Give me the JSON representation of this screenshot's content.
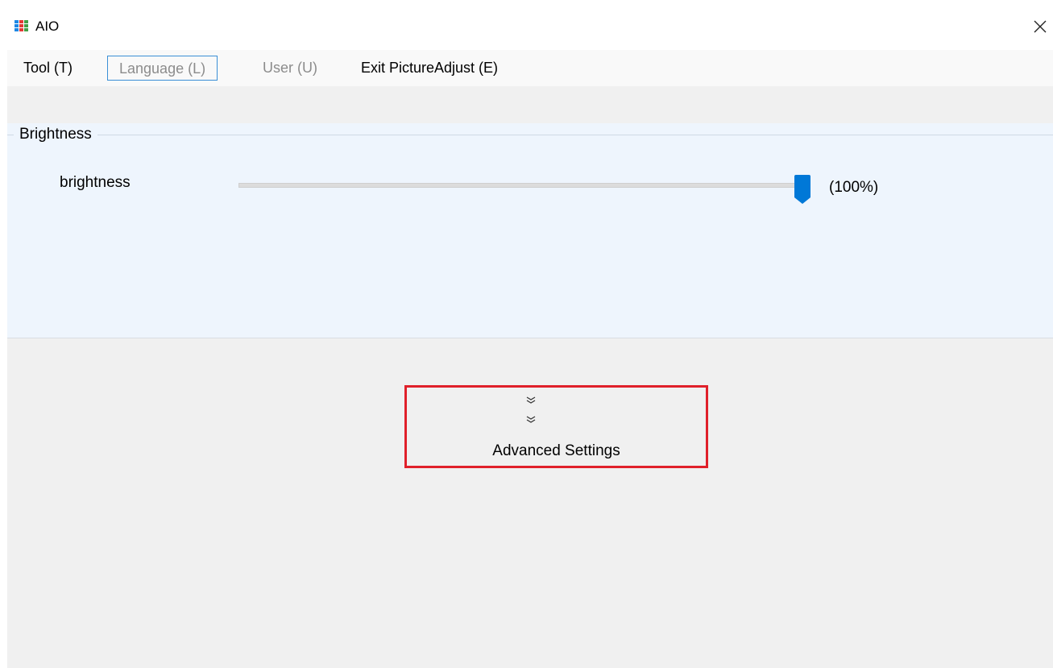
{
  "window": {
    "title": "AIO",
    "close_symbol": "✕"
  },
  "menu": {
    "items": [
      {
        "label": "Tool (T)",
        "state": "normal"
      },
      {
        "label": "Language (L)",
        "state": "focused-disabled"
      },
      {
        "label": "User (U)",
        "state": "disabled"
      },
      {
        "label": "Exit PictureAdjust (E)",
        "state": "normal"
      }
    ]
  },
  "brightness_group": {
    "title": "Brightness",
    "slider": {
      "label": "brightness",
      "value_text": "(100%)",
      "value_percent": 100
    }
  },
  "advanced": {
    "label": "Advanced Settings",
    "icons": [
      "double-chevron-down-icon",
      "double-chevron-down-icon"
    ]
  },
  "colors": {
    "accent": "#0078d7",
    "focus_border": "#3a8fd6",
    "highlight_box": "#e0202a",
    "group_background": "#eef5fd"
  }
}
